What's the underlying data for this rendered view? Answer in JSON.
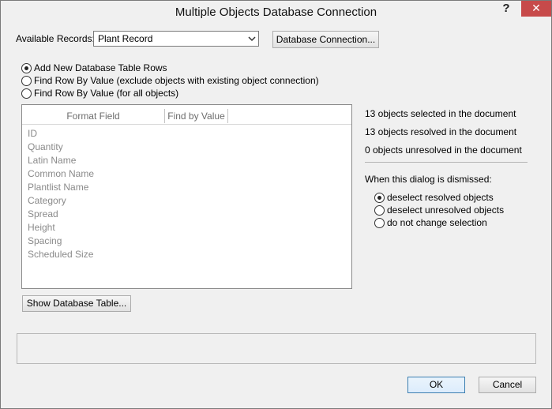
{
  "window": {
    "title": "Multiple Objects Database Connection",
    "help_glyph": "?",
    "close_glyph": "✕"
  },
  "records": {
    "label": "Available Records:",
    "selected": "Plant Record",
    "db_connection_button": "Database Connection..."
  },
  "mode_options": [
    {
      "label": "Add New Database Table Rows",
      "checked": true
    },
    {
      "label": "Find Row By Value (exclude objects with existing object connection)",
      "checked": false
    },
    {
      "label": "Find Row By Value (for all objects)",
      "checked": false
    }
  ],
  "table": {
    "columns": [
      "Format Field",
      "Find by Value"
    ],
    "rows": [
      "ID",
      "Quantity",
      "Latin Name",
      "Common Name",
      "Plantlist Name",
      "Category",
      "Spread",
      "Height",
      "Spacing",
      "Scheduled Size"
    ]
  },
  "status": {
    "selected": "13 objects selected in the document",
    "resolved": "13 objects resolved in the document",
    "unresolved": "0 objects unresolved in the document"
  },
  "dismiss": {
    "label": "When this dialog is dismissed:",
    "options": [
      {
        "label": "deselect resolved objects",
        "checked": true
      },
      {
        "label": "deselect unresolved objects",
        "checked": false
      },
      {
        "label": "do not change selection",
        "checked": false
      }
    ]
  },
  "buttons": {
    "show_table": "Show Database Table...",
    "ok": "OK",
    "cancel": "Cancel"
  }
}
